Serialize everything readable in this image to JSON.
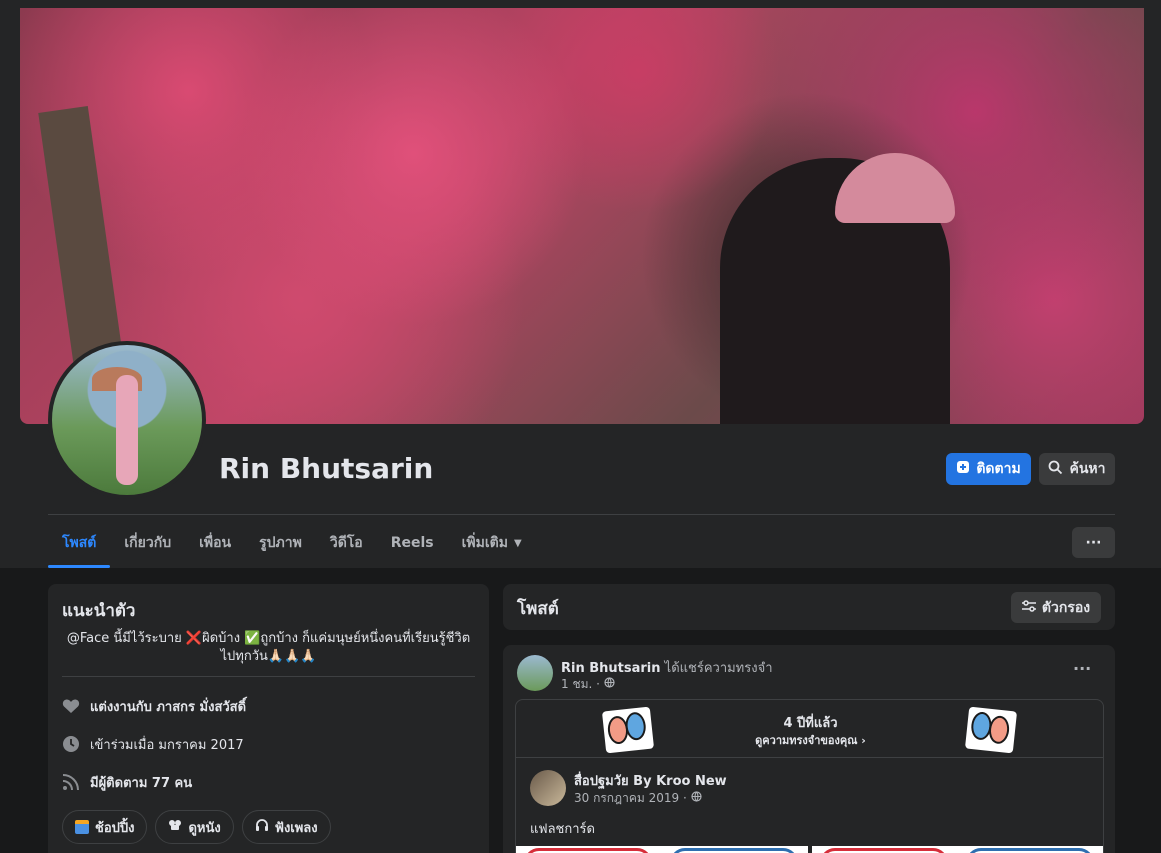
{
  "profile": {
    "name": "Rin Bhutsarin",
    "follow_label": "ติดตาม",
    "search_label": "ค้นหา"
  },
  "tabs": [
    {
      "label": "โพสต์",
      "active": true
    },
    {
      "label": "เกี่ยวกับ"
    },
    {
      "label": "เพื่อน"
    },
    {
      "label": "รูปภาพ"
    },
    {
      "label": "วิดีโอ"
    },
    {
      "label": "Reels"
    },
    {
      "label": "เพิ่มเติม"
    }
  ],
  "more_label": "···",
  "intro": {
    "title": "แนะนำตัว",
    "bio": "@Face นี้มีไว้ระบาย ❌ผิดบ้าง ✅ถูกบ้าง ก็แค่มนุษย์หนึ่งคนที่เรียนรู้ชีวิตไปทุกวัน🙏🏻🙏🏻🙏🏻",
    "married": "แต่งงานกับ ภาสกร มั่งสวัสดิ์",
    "joined": "เข้าร่วมเมื่อ มกราคม 2017",
    "followers": "มีผู้ติดตาม 77 คน",
    "chips": [
      "ช้อปปิ้ง",
      "ดูหนัง",
      "ฟังเพลง"
    ]
  },
  "posts": {
    "title": "โพสต์",
    "filter_label": "ตัวกรอง",
    "post": {
      "author": "Rin Bhutsarin",
      "action": "ได้แชร์ความทรงจำ",
      "time": "1 ชม. ·",
      "more": "···",
      "memory_years": "4 ปีที่แล้ว",
      "memory_link": "ดูความทรงจำของคุณ ›",
      "shared_name": "สื่อปฐมวัย By Kroo New",
      "shared_date": "30 กรกฎาคม 2019 ·",
      "shared_text": "แฟลชการ์ด"
    }
  },
  "colors": {
    "background": "#18191a",
    "surface": "#242526",
    "accent": "#2374e1",
    "active_tab": "#2d88ff"
  }
}
